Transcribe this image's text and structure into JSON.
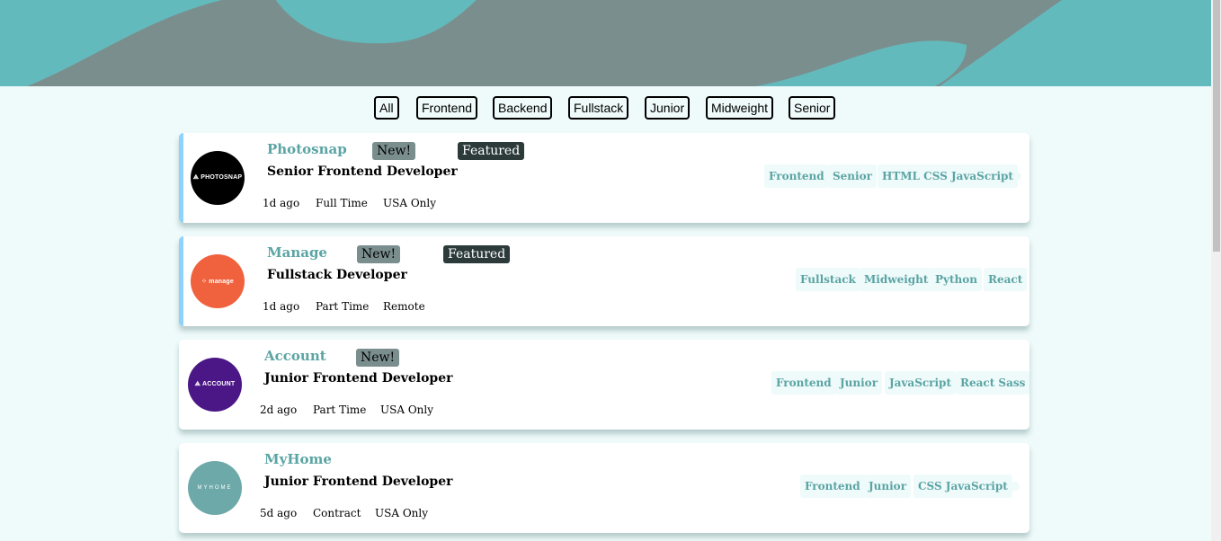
{
  "colors": {
    "primary": "#5ba4a4",
    "background": "#effafa",
    "header": "#63babc",
    "header_shape": "#7b8e8e",
    "new_badge": "#7b8e8e",
    "featured_badge": "#2c3a3a",
    "featured_border": "#8fd2fb"
  },
  "filters": [
    "All",
    "Frontend",
    "Backend",
    "Fullstack",
    "Junior",
    "Midweight",
    "Senior"
  ],
  "jobs": [
    {
      "company": "Photosnap",
      "logo_text": "⟁ PHOTOSNAP",
      "logo_color": "#000000",
      "new": "New!",
      "featured": "Featured",
      "position": "Senior Frontend Developer",
      "posted": "1d ago",
      "contract": "Full Time",
      "location": "USA Only",
      "tags": [
        "Frontend",
        "Senior",
        "HTML CSS JavaScript"
      ]
    },
    {
      "company": "Manage",
      "logo_text": "⁘ manage",
      "logo_color": "#f0623e",
      "new": "New!",
      "featured": "Featured",
      "position": "Fullstack Developer",
      "posted": "1d ago",
      "contract": "Part Time",
      "location": "Remote",
      "tags": [
        "Fullstack",
        "Midweight",
        "Python",
        "React"
      ]
    },
    {
      "company": "Account",
      "logo_text": "⟁ ACCOUNT",
      "logo_color": "#4b1786",
      "new": "New!",
      "featured": "",
      "position": "Junior Frontend Developer",
      "posted": "2d ago",
      "contract": "Part Time",
      "location": "USA Only",
      "tags": [
        "Frontend",
        "Junior",
        "JavaScript",
        "React Sass"
      ]
    },
    {
      "company": "MyHome",
      "logo_text": "MYHOME",
      "logo_color": "#6ea9a9",
      "new": "",
      "featured": "",
      "position": "Junior Frontend Developer",
      "posted": "5d ago",
      "contract": "Contract",
      "location": "USA Only",
      "tags": [
        "Frontend",
        "Junior",
        "CSS JavaScript"
      ]
    }
  ]
}
